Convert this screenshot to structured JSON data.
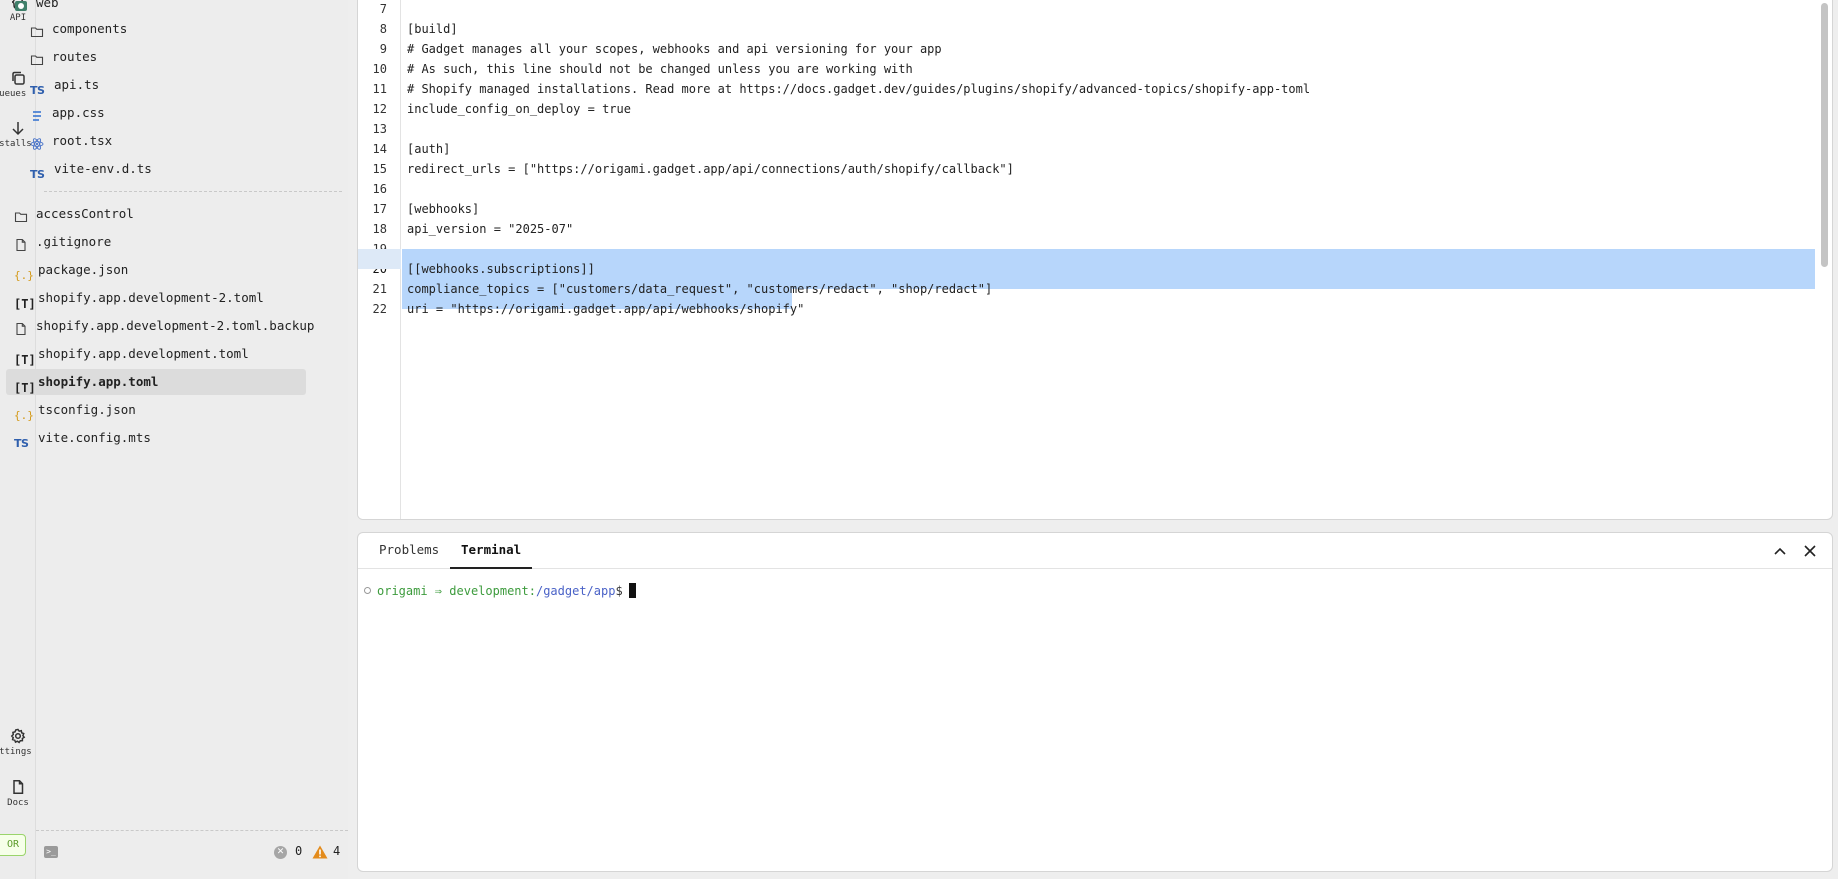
{
  "rail": {
    "items": [
      {
        "label": "API",
        "icon": "braces-icon"
      },
      {
        "label": "Queues",
        "icon": "queues-icon"
      },
      {
        "label": "Installs",
        "icon": "arrow-down-icon"
      },
      {
        "label": "Settings",
        "icon": "gear-icon"
      },
      {
        "label": "Docs",
        "icon": "document-icon"
      }
    ],
    "badge": "OR"
  },
  "tree": {
    "web_folder": "web",
    "web_children": [
      {
        "name": "components",
        "type": "folder"
      },
      {
        "name": "routes",
        "type": "folder"
      },
      {
        "name": "api.ts",
        "type": "ts"
      },
      {
        "name": "app.css",
        "type": "css"
      },
      {
        "name": "root.tsx",
        "type": "react"
      },
      {
        "name": "vite-env.d.ts",
        "type": "ts"
      }
    ],
    "root_items": [
      {
        "name": "accessControl",
        "type": "folder"
      },
      {
        "name": ".gitignore",
        "type": "file"
      },
      {
        "name": "package.json",
        "type": "json"
      },
      {
        "name": "shopify.app.development-2.toml",
        "type": "toml"
      },
      {
        "name": "shopify.app.development-2.toml.backup",
        "type": "file"
      },
      {
        "name": "shopify.app.development.toml",
        "type": "toml"
      },
      {
        "name": "shopify.app.toml",
        "type": "toml",
        "selected": true
      },
      {
        "name": "tsconfig.json",
        "type": "json"
      },
      {
        "name": "vite.config.mts",
        "type": "ts"
      }
    ],
    "icon_glyphs": {
      "ts": "TS",
      "toml": "[T]",
      "json": "{.}"
    },
    "footer": {
      "errors": "0",
      "warnings": "4"
    }
  },
  "editor": {
    "lines": [
      {
        "n": "7",
        "text": ""
      },
      {
        "n": "8",
        "text": "[build]"
      },
      {
        "n": "9",
        "text": "# Gadget manages all your scopes, webhooks and api versioning for your app"
      },
      {
        "n": "10",
        "text": "# As such, this line should not be changed unless you are working with"
      },
      {
        "n": "11",
        "text": "# Shopify managed installations. Read more at https://docs.gadget.dev/guides/plugins/shopify/advanced-topics/shopify-app-toml"
      },
      {
        "n": "12",
        "text": "include_config_on_deploy = true"
      },
      {
        "n": "13",
        "text": ""
      },
      {
        "n": "14",
        "text": "[auth]"
      },
      {
        "n": "15",
        "text": "redirect_urls = [\"https://origami.gadget.app/api/connections/auth/shopify/callback\"]"
      },
      {
        "n": "16",
        "text": ""
      },
      {
        "n": "17",
        "text": "[webhooks]"
      },
      {
        "n": "18",
        "text": "api_version = \"2025-07\""
      },
      {
        "n": "19",
        "text": ""
      },
      {
        "n": "20",
        "text": "[[webhooks.subscriptions]]"
      },
      {
        "n": "21",
        "text": "compliance_topics = [\"customers/data_request\", \"customers/redact\", \"shop/redact\"]"
      },
      {
        "n": "22",
        "text": "uri = \"https://origami.gadget.app/api/webhooks/shopify\""
      }
    ]
  },
  "panel": {
    "tabs": [
      {
        "label": "Problems",
        "active": false
      },
      {
        "label": "Terminal",
        "active": true
      }
    ],
    "prompt": {
      "user": "origami",
      "arrow": " ⇒ ",
      "env": "development:",
      "path": "/gadget/app",
      "dollar": "$"
    }
  },
  "colors": {
    "selection": "#b7d6fb",
    "prompt_green": "#3d9b3d",
    "prompt_blue": "#4a62c7",
    "ts_blue": "#2f5fad",
    "json_orange": "#d49a1a",
    "warning_orange": "#e38b1c"
  }
}
